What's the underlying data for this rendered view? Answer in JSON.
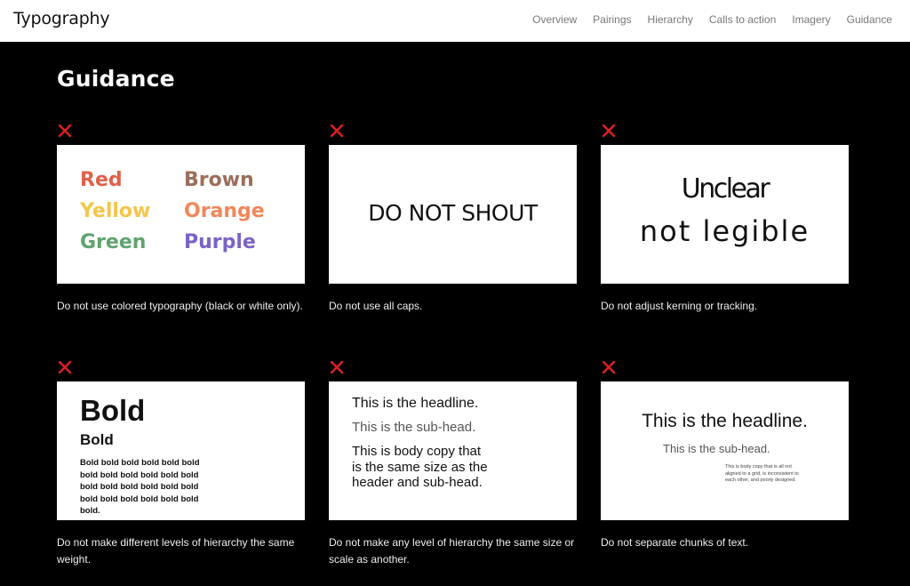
{
  "header": {
    "brand": "Typography",
    "nav": [
      "Overview",
      "Pairings",
      "Hierarchy",
      "Calls to action",
      "Imagery",
      "Guidance"
    ]
  },
  "section": {
    "title": "Guidance"
  },
  "icons": {
    "dont": "close-icon",
    "dont_color": "#e02020"
  },
  "examples": [
    {
      "colors": [
        {
          "word": "Red",
          "color": "#e0604c"
        },
        {
          "word": "Brown",
          "color": "#9b6e5a"
        },
        {
          "word": "Yellow",
          "color": "#f3c64c"
        },
        {
          "word": "Orange",
          "color": "#f0875a"
        },
        {
          "word": "Green",
          "color": "#5fa36e"
        },
        {
          "word": "Purple",
          "color": "#7a63c4"
        }
      ],
      "caption": "Do not use colored typography (black or white only)."
    },
    {
      "text": "DO NOT SHOUT",
      "caption": "Do not use all caps."
    },
    {
      "line1": "Unclear",
      "line2": "not legible",
      "caption": "Do not adjust kerning or tracking."
    },
    {
      "big": "Bold",
      "medium": "Bold",
      "body": "Bold bold bold bold bold bold bold bold bold bold bold bold bold bold bold bold bold bold bold bold bold bold bold bold bold.",
      "caption": "Do not make different levels of hierarchy the same weight."
    },
    {
      "headline": "This is the headline.",
      "subhead": "This is the sub-head.",
      "body": "This is body copy that is the same size as the header and sub-head.",
      "caption": "Do not make any level of hierarchy the same size or scale as another."
    },
    {
      "headline": "This is the headline.",
      "subhead": "This is the sub-head.",
      "body": "This is body copy that is all not aligned to a grid, is inconsistent to each other, and poorly designed.",
      "caption": "Do not separate chunks of text."
    }
  ]
}
